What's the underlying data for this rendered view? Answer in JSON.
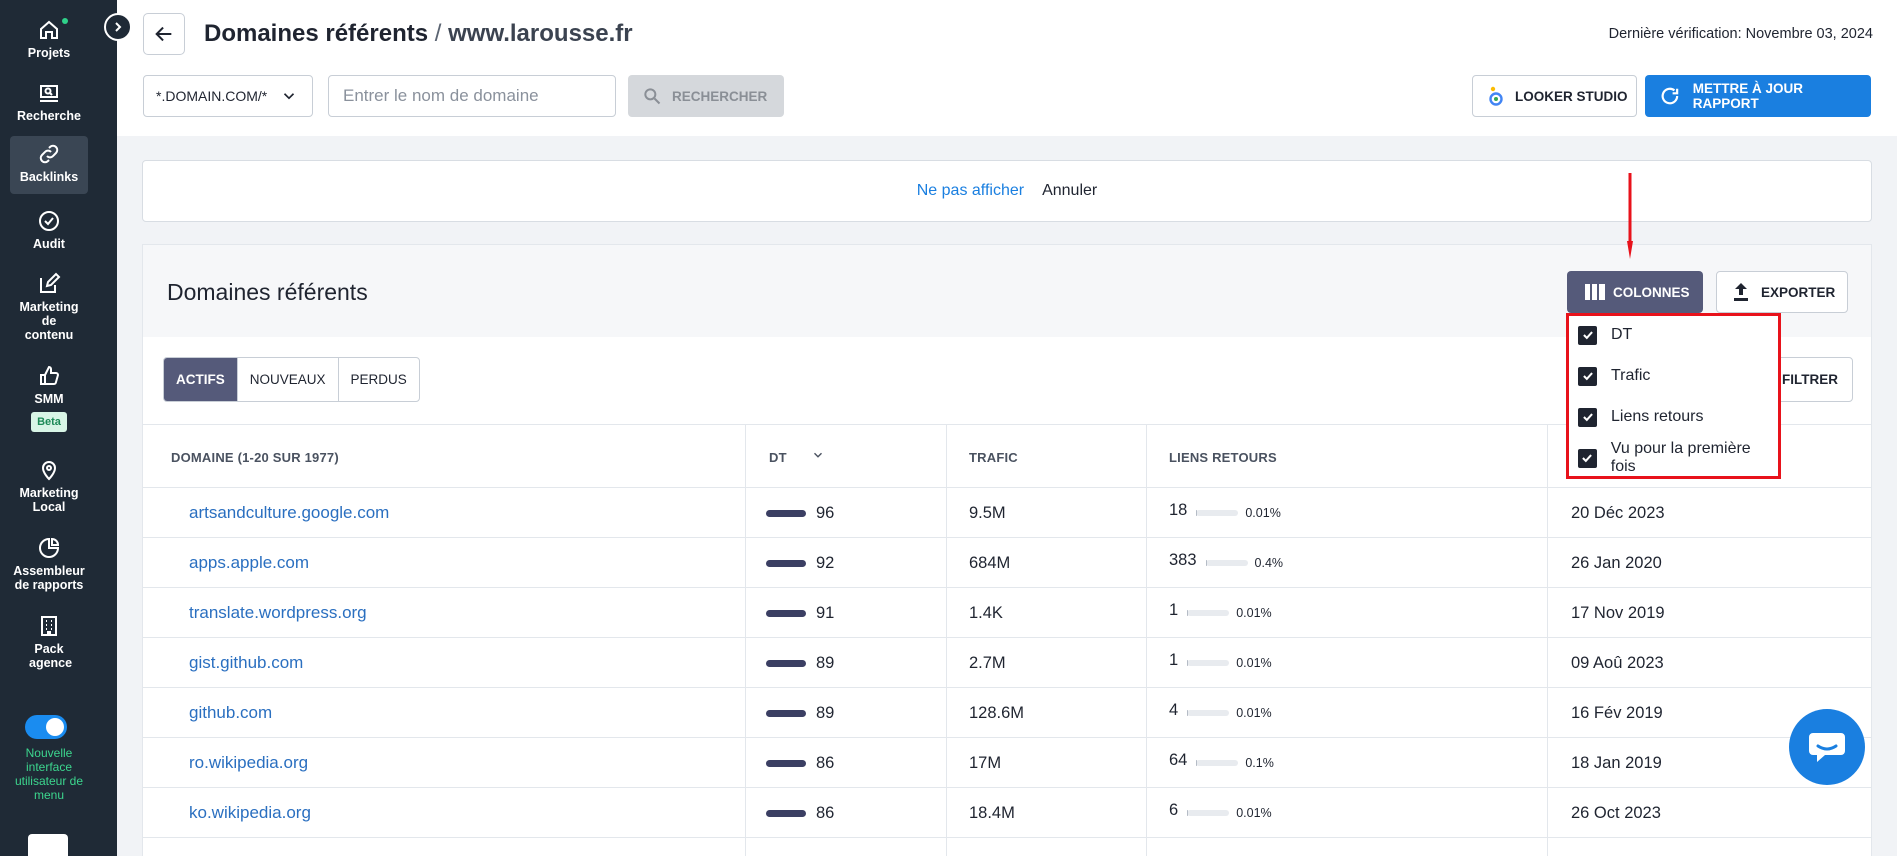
{
  "sidebar": {
    "items": [
      {
        "label": "Projets",
        "icon": "home-icon"
      },
      {
        "label": "Recherche",
        "icon": "monitor-search-icon"
      },
      {
        "label": "Backlinks",
        "icon": "link-icon"
      },
      {
        "label": "Audit",
        "icon": "check-circle-icon"
      },
      {
        "label": "Marketing de contenu",
        "icon": "edit-icon"
      },
      {
        "label": "SMM",
        "icon": "thumbs-up-icon"
      },
      {
        "label": "Marketing Local",
        "icon": "map-pin-icon"
      },
      {
        "label": "Assembleur de rapports",
        "icon": "pie-chart-icon"
      },
      {
        "label": "Pack agence",
        "icon": "building-icon"
      }
    ],
    "beta_badge": "Beta",
    "new_ui_label": "Nouvelle interface utilisateur de menu"
  },
  "header": {
    "title": "Domaines référents",
    "separator": "/",
    "site": "www.larousse.fr",
    "last_check": "Dernière vérification: Novembre 03, 2024",
    "scope_select": "*.DOMAIN.COM/*",
    "domain_placeholder": "Entrer le nom de domaine",
    "search_label": "RECHERCHER",
    "looker_label": "LOOKER STUDIO",
    "update_label": "METTRE À JOUR RAPPORT"
  },
  "notice": {
    "hide_label": "Ne pas afficher",
    "cancel_label": "Annuler"
  },
  "panel": {
    "title": "Domaines référents",
    "columns_label": "COLONNES",
    "export_label": "EXPORTER",
    "filter_label": "FILTRER",
    "tabs": [
      "ACTIFS",
      "NOUVEAUX",
      "PERDUS"
    ],
    "active_tab": "ACTIFS"
  },
  "columns_menu": [
    "DT",
    "Trafic",
    "Liens retours",
    "Vu pour la première fois"
  ],
  "table": {
    "headers": {
      "domain": "DOMAINE (1-20 SUR 1977)",
      "dt": "DT",
      "traffic": "TRAFIC",
      "backlinks": "LIENS RETOURS"
    },
    "rows": [
      {
        "domain": "artsandculture.google.com",
        "dt": "96",
        "traffic": "9.5M",
        "backlinks": "18",
        "pct": "0.01%",
        "first_seen": "20 Déc 2023"
      },
      {
        "domain": "apps.apple.com",
        "dt": "92",
        "traffic": "684M",
        "backlinks": "383",
        "pct": "0.4%",
        "first_seen": "26 Jan 2020"
      },
      {
        "domain": "translate.wordpress.org",
        "dt": "91",
        "traffic": "1.4K",
        "backlinks": "1",
        "pct": "0.01%",
        "first_seen": "17 Nov 2019"
      },
      {
        "domain": "gist.github.com",
        "dt": "89",
        "traffic": "2.7M",
        "backlinks": "1",
        "pct": "0.01%",
        "first_seen": "09 Aoû 2023"
      },
      {
        "domain": "github.com",
        "dt": "89",
        "traffic": "128.6M",
        "backlinks": "4",
        "pct": "0.01%",
        "first_seen": "16 Fév 2019"
      },
      {
        "domain": "ro.wikipedia.org",
        "dt": "86",
        "traffic": "17M",
        "backlinks": "64",
        "pct": "0.1%",
        "first_seen": "18 Jan 2019"
      },
      {
        "domain": "ko.wikipedia.org",
        "dt": "86",
        "traffic": "18.4M",
        "backlinks": "6",
        "pct": "0.01%",
        "first_seen": "26 Oct 2023"
      }
    ]
  },
  "colors": {
    "sidebar_bg": "#1f2a36",
    "accent_blue": "#1a7fe0",
    "columns_button": "#555a7a",
    "highlight_red": "#e8121b",
    "link": "#2a6fc0"
  }
}
